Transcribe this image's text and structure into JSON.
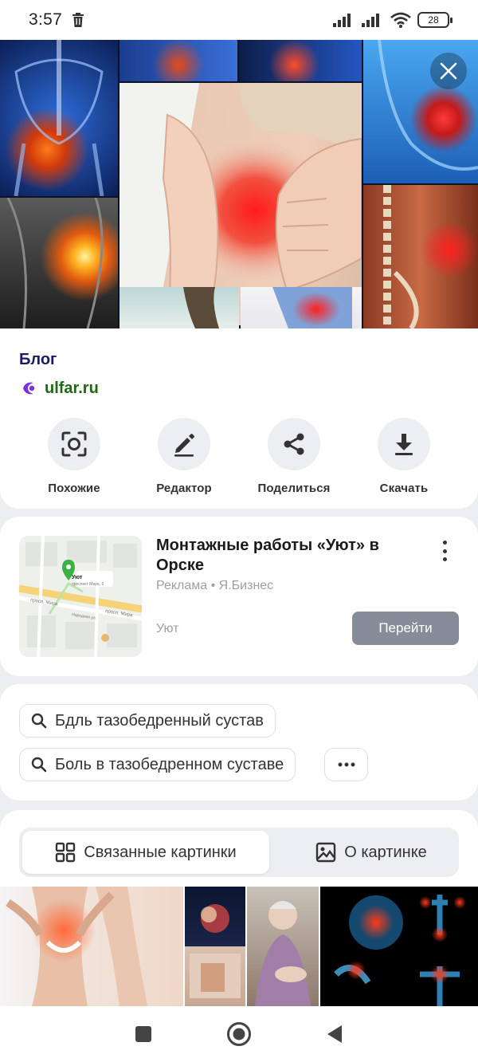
{
  "status_bar": {
    "time": "3:57",
    "battery": "28"
  },
  "image_info": {
    "title": "Блог",
    "source": "ulfar.ru"
  },
  "actions": [
    {
      "label": "Похожие",
      "icon": "lens-icon"
    },
    {
      "label": "Редактор",
      "icon": "pencil-icon"
    },
    {
      "label": "Поделиться",
      "icon": "share-icon"
    },
    {
      "label": "Скачать",
      "icon": "download-icon"
    }
  ],
  "ad": {
    "title": "Монтажные работы «Уют» в Орске",
    "meta": "Реклама • Я.Бизнес",
    "brand": "Уют",
    "button": "Перейти",
    "map": {
      "place": "Уют",
      "address": "проспект Мира, 6",
      "street1": "просп. Мира",
      "street2": "просп. Мира",
      "street3": "Народная ул."
    }
  },
  "queries": [
    "Бдль тазобедренный сустав",
    "Боль в тазобедренном суставе"
  ],
  "related": {
    "tab_related": "Связанные картинки",
    "tab_about": "О картинке"
  },
  "colors": {
    "link_title": "#1a1a66",
    "source_green": "#1c6a12",
    "button_grey": "#868d98"
  }
}
